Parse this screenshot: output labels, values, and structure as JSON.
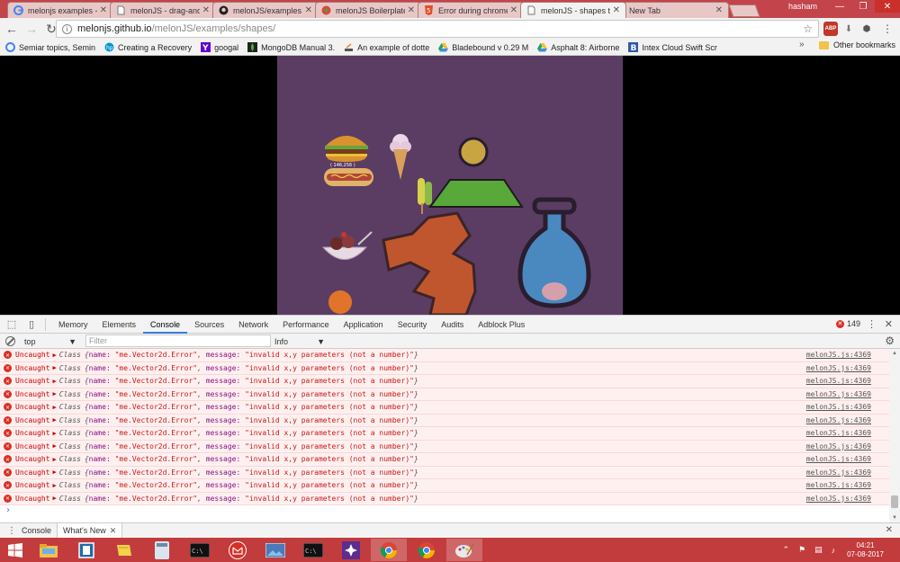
{
  "browser": {
    "tabs": [
      {
        "title": "melonjs examples - G",
        "active": false
      },
      {
        "title": "melonJS - drag-and-",
        "active": false
      },
      {
        "title": "melonJS/examples a",
        "active": false
      },
      {
        "title": "melonJS Boilerplate",
        "active": false
      },
      {
        "title": "Error during chrome",
        "active": false
      },
      {
        "title": "melonJS - shapes te",
        "active": true
      },
      {
        "title": "New Tab",
        "active": false
      }
    ],
    "user": "hasham",
    "window_controls": {
      "minimize": "—",
      "maximize": "❐",
      "close": "✕"
    },
    "url_host": "melonjs.github.io",
    "url_path": "/melonJS/examples/shapes/",
    "bookmarks": [
      "Semiar topics, Semin",
      "Creating a Recovery",
      "googal",
      "MongoDB Manual 3.",
      "An example of dotte",
      "Bladebound v 0.29 M",
      "Asphalt 8: Airborne",
      "Intex Cloud Swift Scr"
    ],
    "bookmarks_more": "»",
    "other_bookmarks": "Other bookmarks",
    "extensions": {
      "adblock_label": "ABP"
    }
  },
  "canvas_scene": {
    "burger_label": "( 146,256 )"
  },
  "devtools": {
    "tabs": [
      "Memory",
      "Elements",
      "Console",
      "Sources",
      "Network",
      "Performance",
      "Application",
      "Security",
      "Audits",
      "Adblock Plus"
    ],
    "active_tab": "Console",
    "error_count": "149",
    "context": "top",
    "filter_placeholder": "Filter",
    "level": "Info",
    "error_rows": [
      {
        "prefix": "Uncaught",
        "cls": "Class",
        "name_key": "name:",
        "name_val": "\"me.Vector2d.Error\"",
        "msg_key": "message:",
        "msg_val": "\"invalid x,y parameters (not a number)\"",
        "source": "melonJS.js:4369"
      },
      {
        "prefix": "Uncaught",
        "cls": "Class",
        "name_key": "name:",
        "name_val": "\"me.Vector2d.Error\"",
        "msg_key": "message:",
        "msg_val": "\"invalid x,y parameters (not a number)\"",
        "source": "melonJS.js:4369"
      },
      {
        "prefix": "Uncaught",
        "cls": "Class",
        "name_key": "name:",
        "name_val": "\"me.Vector2d.Error\"",
        "msg_key": "message:",
        "msg_val": "\"invalid x,y parameters (not a number)\"",
        "source": "melonJS.js:4369"
      },
      {
        "prefix": "Uncaught",
        "cls": "Class",
        "name_key": "name:",
        "name_val": "\"me.Vector2d.Error\"",
        "msg_key": "message:",
        "msg_val": "\"invalid x,y parameters (not a number)\"",
        "source": "melonJS.js:4369"
      },
      {
        "prefix": "Uncaught",
        "cls": "Class",
        "name_key": "name:",
        "name_val": "\"me.Vector2d.Error\"",
        "msg_key": "message:",
        "msg_val": "\"invalid x,y parameters (not a number)\"",
        "source": "melonJS.js:4369"
      },
      {
        "prefix": "Uncaught",
        "cls": "Class",
        "name_key": "name:",
        "name_val": "\"me.Vector2d.Error\"",
        "msg_key": "message:",
        "msg_val": "\"invalid x,y parameters (not a number)\"",
        "source": "melonJS.js:4369"
      },
      {
        "prefix": "Uncaught",
        "cls": "Class",
        "name_key": "name:",
        "name_val": "\"me.Vector2d.Error\"",
        "msg_key": "message:",
        "msg_val": "\"invalid x,y parameters (not a number)\"",
        "source": "melonJS.js:4369"
      },
      {
        "prefix": "Uncaught",
        "cls": "Class",
        "name_key": "name:",
        "name_val": "\"me.Vector2d.Error\"",
        "msg_key": "message:",
        "msg_val": "\"invalid x,y parameters (not a number)\"",
        "source": "melonJS.js:4369"
      },
      {
        "prefix": "Uncaught",
        "cls": "Class",
        "name_key": "name:",
        "name_val": "\"me.Vector2d.Error\"",
        "msg_key": "message:",
        "msg_val": "\"invalid x,y parameters (not a number)\"",
        "source": "melonJS.js:4369"
      },
      {
        "prefix": "Uncaught",
        "cls": "Class",
        "name_key": "name:",
        "name_val": "\"me.Vector2d.Error\"",
        "msg_key": "message:",
        "msg_val": "\"invalid x,y parameters (not a number)\"",
        "source": "melonJS.js:4369"
      },
      {
        "prefix": "Uncaught",
        "cls": "Class",
        "name_key": "name:",
        "name_val": "\"me.Vector2d.Error\"",
        "msg_key": "message:",
        "msg_val": "\"invalid x,y parameters (not a number)\"",
        "source": "melonJS.js:4369"
      },
      {
        "prefix": "Uncaught",
        "cls": "Class",
        "name_key": "name:",
        "name_val": "\"me.Vector2d.Error\"",
        "msg_key": "message:",
        "msg_val": "\"invalid x,y parameters (not a number)\"",
        "source": "melonJS.js:4369"
      }
    ],
    "prompt": "›",
    "drawer_tabs": [
      "Console",
      "What's New"
    ],
    "drawer_active": "What's New"
  },
  "taskbar": {
    "time": "04:21",
    "date": "07-08-2017"
  },
  "colors": {
    "chrome_frame": "#c3444b",
    "canvas_bg": "#5b3d63",
    "error_bg": "#fff0f0",
    "taskbar": "#c23c3d"
  }
}
